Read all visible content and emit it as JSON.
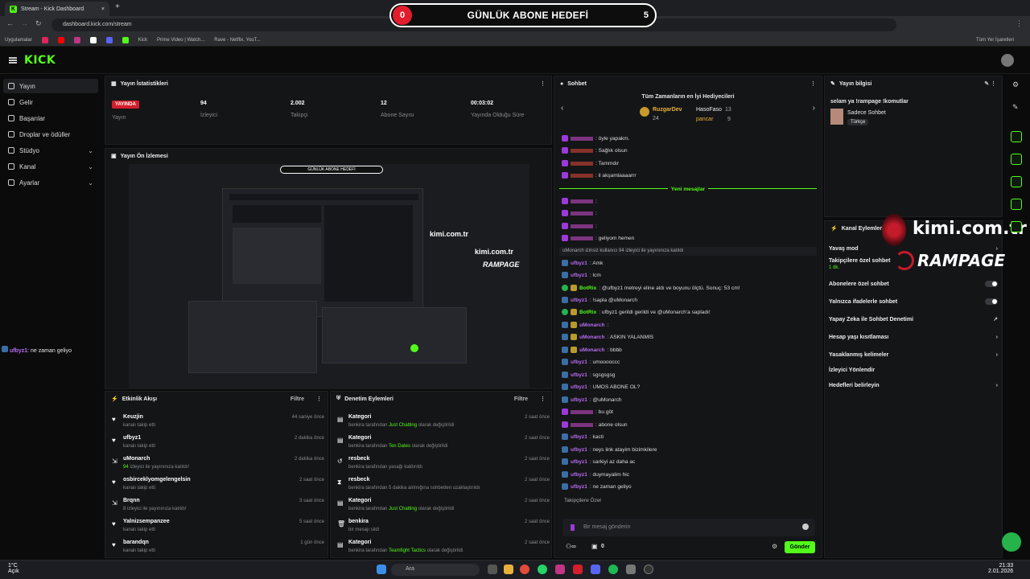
{
  "browser": {
    "tab_title": "Stream - Kick Dashboard",
    "url": "dashboard.kick.com/stream",
    "bookmarks": [
      "Uygulamalar",
      "Kick",
      "Prime Video | Watch...",
      "Rave - Netflix, YouT..."
    ],
    "all_bookmarks": "Tüm Yer İşaretleri",
    "new_tab": "+"
  },
  "overlay": {
    "left": "0",
    "title": "GÜNLÜK ABONE HEDEFİ",
    "right": "5"
  },
  "logo": "KICK",
  "sidebar": {
    "items": [
      {
        "label": "Yayın"
      },
      {
        "label": "Gelir"
      },
      {
        "label": "Başarılar"
      },
      {
        "label": "Droplar ve ödüller"
      },
      {
        "label": "Stüdyo"
      },
      {
        "label": "Kanal"
      },
      {
        "label": "Ayarlar"
      }
    ]
  },
  "side_chat": {
    "user": "ufbyz1",
    "message": ": ne zaman geliyo"
  },
  "stats": {
    "title": "Yayın İstatistikleri",
    "items": [
      {
        "value": "YAYINDA",
        "label": "Yayın"
      },
      {
        "value": "94",
        "label": "İzleyici"
      },
      {
        "value": "2.002",
        "label": "Takipçi"
      },
      {
        "value": "12",
        "label": "Abone Sayısı"
      },
      {
        "value": "00:03:02",
        "label": "Yayında Olduğu Süre"
      }
    ]
  },
  "preview": {
    "title": "Yayın Ön İzlemesi",
    "overlay_text": "GÜNLÜK ABONE HEDEFİ",
    "brand1": "kimi.com.tr",
    "brand2": "RAMPAGE"
  },
  "activity": {
    "title": "Etkinlik Akışı",
    "filter": "Filtre",
    "rows": [
      {
        "name": "Keuzjin",
        "sub": "kanalı takip etti",
        "time": "44 saniye önce"
      },
      {
        "name": "ufbyz1",
        "sub": "kanalı takip etti",
        "time": "2 dakika önce"
      },
      {
        "name": "uMonarch",
        "sub_g": "94",
        "sub": " izleyici ile yayınınıza katıldı!",
        "time": "2 dakika önce"
      },
      {
        "name": "osbirceklyomgelengelsin",
        "sub": "kanalı takip etti",
        "time": "2 saat önce"
      },
      {
        "name": "Brqnn",
        "sub": "8 izleyici ile yayınınıza katıldı!",
        "time": "3 saat önce"
      },
      {
        "name": "Yalnizsempanzee",
        "sub": "kanalı takip etti",
        "time": "5 saat önce"
      },
      {
        "name": "barandqn",
        "sub": "kanalı takip etti",
        "time": "1 gün önce"
      }
    ]
  },
  "moderation": {
    "title": "Denetim Eylemleri",
    "filter": "Filtre",
    "rows": [
      {
        "name": "Kategori",
        "sub": "benkira tarafından ",
        "g": "Just Chatting",
        "sub2": " olarak değiştirildi",
        "time": "2 saat önce"
      },
      {
        "name": "Kategori",
        "sub": "benkira tarafından ",
        "g": "Ten Dates",
        "sub2": " olarak değiştirildi",
        "time": "2 saat önce"
      },
      {
        "name": "resbeck",
        "sub": "benkira tarafından yasağı kaldırıldı",
        "g": "",
        "sub2": "",
        "time": "2 saat önce"
      },
      {
        "name": "resbeck",
        "sub": "benkira tarafından 5 dakika alılmığına sohbetten uzaklaştırıldı",
        "g": "",
        "sub2": "",
        "time": "2 saat önce"
      },
      {
        "name": "Kategori",
        "sub": "benkira tarafından ",
        "g": "Just Chatting",
        "sub2": " olarak değiştirildi",
        "time": "2 saat önce"
      },
      {
        "name": "benkira",
        "sub": "bir mesajı sildi",
        "g": "",
        "sub2": "",
        "time": "2 saat önce"
      },
      {
        "name": "Kategori",
        "sub": "benkira tarafından ",
        "g": "Teamfight Tactics",
        "sub2": " olarak değiştirildi",
        "time": "2 saat önce"
      }
    ]
  },
  "chat": {
    "title": "Sohbet",
    "gifters_title": "Tüm Zamanların en İyi Hediyecileri",
    "top": {
      "name": "RuzgarDev",
      "count": "24"
    },
    "g2": {
      "name": "HasoFaso",
      "count": "13"
    },
    "g3": {
      "name": "pancar",
      "count": "9"
    },
    "new_messages": "Yeni mesajlar",
    "system": "uMonarch izinsiz kullanıcı 94 izleyici ile yayınınıza katıldı",
    "lines": [
      {
        "user": "",
        "msg": ": öyle yapakm.",
        "color": "#d24fd6"
      },
      {
        "user": "",
        "msg": ": Sağlık olsun",
        "color": "#e34b3a"
      },
      {
        "user": "",
        "msg": ": Tammdır",
        "color": "#e34b3a"
      },
      {
        "user": "",
        "msg": ": il akşamlaaaarrr",
        "color": "#e34b3a"
      },
      {
        "user": "",
        "msg": ":",
        "color": "#d24fd6"
      },
      {
        "user": "",
        "msg": ":",
        "color": "#d24fd6"
      },
      {
        "user": "",
        "msg": ":",
        "color": "#d24fd6"
      },
      {
        "user": "",
        "msg": ": geliyom hemen",
        "color": "#d24fd6"
      },
      {
        "user": "ufbyz1",
        "msg": ": Amk",
        "color": "#b76cf0"
      },
      {
        "user": "ufbyz1",
        "msg": ": lcm",
        "color": "#b76cf0"
      },
      {
        "user": "BotRix",
        "msg": ": @ufbyz1 metreyi eline aldı ve boyunu ölçtü. Sonuç: 53 cm!",
        "color": "#53fc18"
      },
      {
        "user": "ufbyz1",
        "msg": ": !sapla @uMonarch",
        "color": "#b76cf0"
      },
      {
        "user": "BotRix",
        "msg": ": ufbyz1 gerildi gerildi ve @uMonarch'a sapladı!",
        "color": "#53fc18"
      },
      {
        "user": "uMonarch",
        "msg": ":",
        "color": "#b76cf0"
      },
      {
        "user": "uMonarch",
        "msg": ": ASKIN YALANMIS",
        "color": "#b76cf0"
      },
      {
        "user": "uMonarch",
        "msg": ": bbbb",
        "color": "#b76cf0"
      },
      {
        "user": "ufbyz1",
        "msg": ": umooooccc",
        "color": "#b76cf0"
      },
      {
        "user": "ufbyz1",
        "msg": ": sgsgsgsg",
        "color": "#b76cf0"
      },
      {
        "user": "ufbyz1",
        "msg": ": UMOS ABONE OL?",
        "color": "#b76cf0"
      },
      {
        "user": "ufbyz1",
        "msg": ": @uMonarch",
        "color": "#b76cf0"
      },
      {
        "user": "",
        "msg": ": bu göt",
        "color": "#d24fd6"
      },
      {
        "user": "",
        "msg": ": abone olsun",
        "color": "#d24fd6"
      },
      {
        "user": "ufbyz1",
        "msg": ": kacti",
        "color": "#b76cf0"
      },
      {
        "user": "ufbyz1",
        "msg": ": neys link atayim bizimkilere",
        "color": "#b76cf0"
      },
      {
        "user": "ufbyz1",
        "msg": ": sarkiyi az daha ac",
        "color": "#b76cf0"
      },
      {
        "user": "ufbyz1",
        "msg": ": duymayalim hic",
        "color": "#b76cf0"
      },
      {
        "user": "ufbyz1",
        "msg": ": ne zaman geliyo",
        "color": "#b76cf0"
      }
    ],
    "followers_only": "Takipçilere Özel",
    "input_placeholder": "Bir mesaj gönderin",
    "send": "Gönder",
    "count": "0"
  },
  "stream_info": {
    "title": "Yayın bilgisi",
    "stream_title": "selam ya !rampage !komutlar",
    "category": "Sadece Sohbet",
    "tag": "Türkçe"
  },
  "channel_actions": {
    "title": "Kanal Eylemleri",
    "slow_mode": "Yavaş mod",
    "followers_only": "Takipçilere özel sohbet",
    "followers_sub": "1 dk.",
    "subs_only": "Abonelere özel sohbet",
    "emotes_only": "Yalnızca ifadelerle sohbet",
    "ai_mod": "Yapay Zeka ile Sohbet Denetimi",
    "age": "Hesap yaşı kısıtlaması",
    "banned": "Yasaklanmış kelimeler",
    "raid": "İzleyici Yönlendir",
    "goals": "Hedefleri belirleyin"
  },
  "watermark": {
    "site": "kimi.com.tr",
    "brand": "RAMPAGE"
  },
  "taskbar": {
    "weather_temp": "1°C",
    "weather_text": "Açık",
    "search": "Ara",
    "time": "21:33",
    "date": "2.01.2026"
  },
  "colors": {
    "kick_green": "#53fc18",
    "live_red": "#d31e2b"
  }
}
